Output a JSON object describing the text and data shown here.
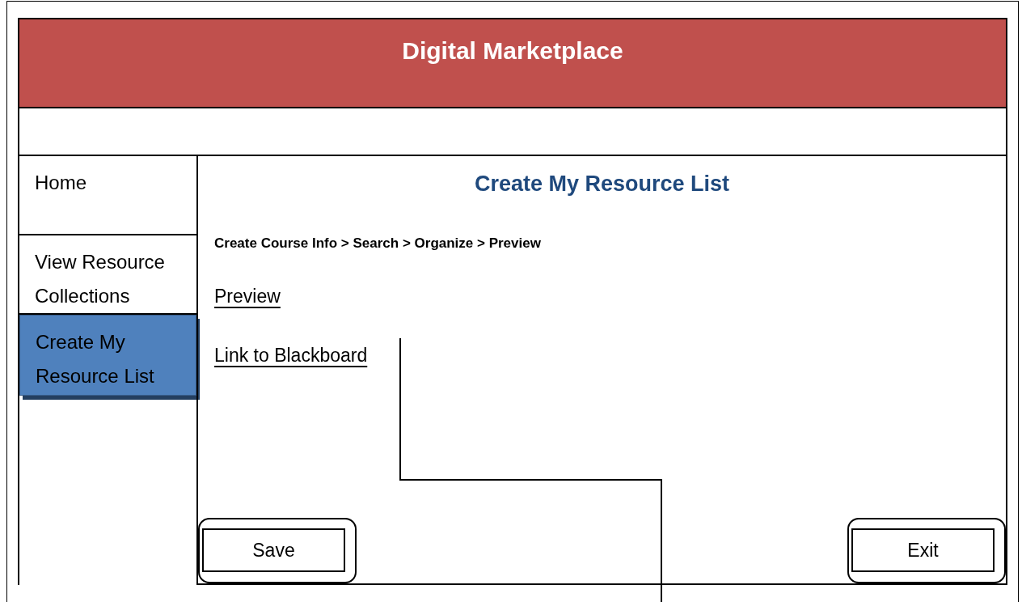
{
  "header": {
    "title": "Digital Marketplace"
  },
  "sidebar": {
    "items": [
      {
        "label": "Home",
        "selected": false
      },
      {
        "label": "View Resource Collections",
        "selected": false
      },
      {
        "label": "Create My Resource List",
        "selected": true
      }
    ]
  },
  "main": {
    "title": "Create My Resource List",
    "breadcrumb": "Create Course Info > Search > Organize > Preview",
    "links": [
      "Preview",
      "Link to Blackboard"
    ]
  },
  "buttons": [
    "Save",
    "Exit"
  ]
}
